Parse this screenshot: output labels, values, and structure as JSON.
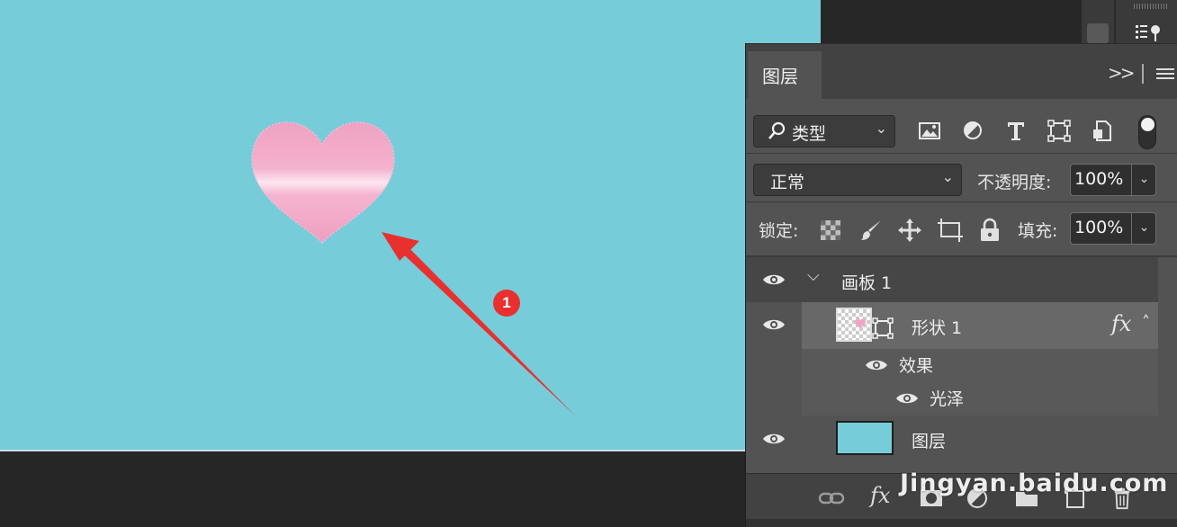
{
  "panel": {
    "tab_label": "图层",
    "filter_label": "类型",
    "blend_mode": "正常",
    "opacity_label": "不透明度:",
    "opacity_value": "100%",
    "lock_label": "锁定:",
    "fill_label": "填充:",
    "fill_value": "100%"
  },
  "layers": {
    "group_name": "画板 1",
    "shape_layer_name": "形状 1",
    "fx_label": "fx",
    "effects_label": "效果",
    "effect_name": "光泽",
    "bg_layer_name": "图层"
  },
  "bottom_bar": {
    "fx_label": "fx"
  },
  "annotation": {
    "badge_number": "1"
  },
  "watermark": "Jingyan.baidu.com",
  "colors": {
    "canvas_bg": "#77ccda",
    "heart_pink": "#f2a6c6",
    "arrow_red": "#e8312f",
    "panel_bg": "#535353",
    "selected_row": "#686868"
  }
}
